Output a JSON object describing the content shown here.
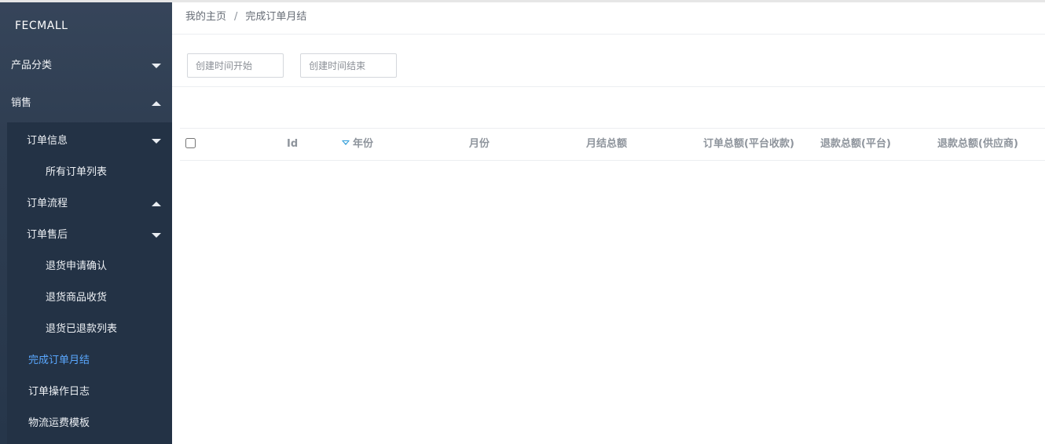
{
  "sidebar": {
    "brand": "FECMALL",
    "sections": [
      {
        "label": "产品分类",
        "state": "collapsed"
      },
      {
        "label": "销售",
        "state": "expanded"
      }
    ],
    "sales_items": [
      {
        "label": "订单信息",
        "state": "collapsed"
      },
      {
        "label": "所有订单列表"
      },
      {
        "label": "订单流程",
        "state": "expanded"
      },
      {
        "label": "订单售后",
        "state": "collapsed"
      },
      {
        "label": "退货申请确认"
      },
      {
        "label": "退货商品收货"
      },
      {
        "label": "退货已退款列表"
      },
      {
        "label": "完成订单月结",
        "active": true
      },
      {
        "label": "订单操作日志"
      },
      {
        "label": "物流运费模板"
      }
    ],
    "active_color": "#5aa8ff"
  },
  "breadcrumb": {
    "home": "我的主页",
    "separator": "/",
    "current": "完成订单月结"
  },
  "filters": {
    "start_placeholder": "创建时间开始",
    "end_placeholder": "创建时间结束",
    "start_value": "",
    "end_value": ""
  },
  "table": {
    "columns": [
      "Id",
      "年份",
      "月份",
      "月结总额",
      "订单总额(平台收款)",
      "退款总额(平台)",
      "退款总额(供应商)"
    ],
    "sorted_column": "年份",
    "rows": []
  }
}
